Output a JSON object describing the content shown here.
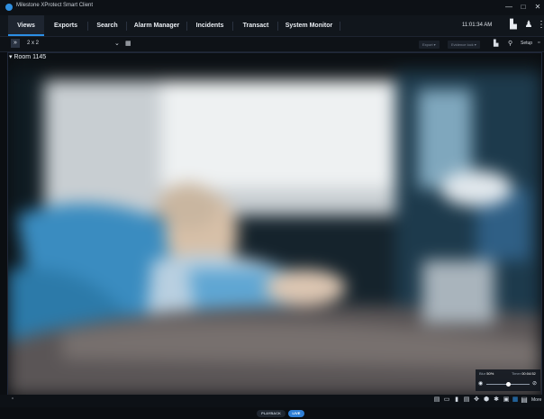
{
  "window": {
    "title": "Milestone XProtect Smart Client",
    "controls": [
      "—",
      "□",
      "✕"
    ]
  },
  "nav": {
    "tabs": [
      "Views",
      "Exports",
      "Search",
      "Alarm Manager",
      "Incidents",
      "Transact",
      "System Monitor"
    ],
    "time": "11:01:34 AM"
  },
  "toolbar": {
    "layout": "2 x 2",
    "export": "Export",
    "evidence_lock": "Evidence lock",
    "setup": "Setup"
  },
  "camera": {
    "name": "Room 1145"
  },
  "overlay": {
    "blur_label": "Blur",
    "blur_value": "50%",
    "timer_label": "Timer",
    "timer_value": "00:04:52"
  },
  "controls": {
    "more": "More"
  },
  "modes": {
    "playback": "PLAYBACK",
    "live": "LIVE"
  },
  "colors": {
    "accent": "#2c8fe6",
    "live": "#2f7fd6"
  }
}
